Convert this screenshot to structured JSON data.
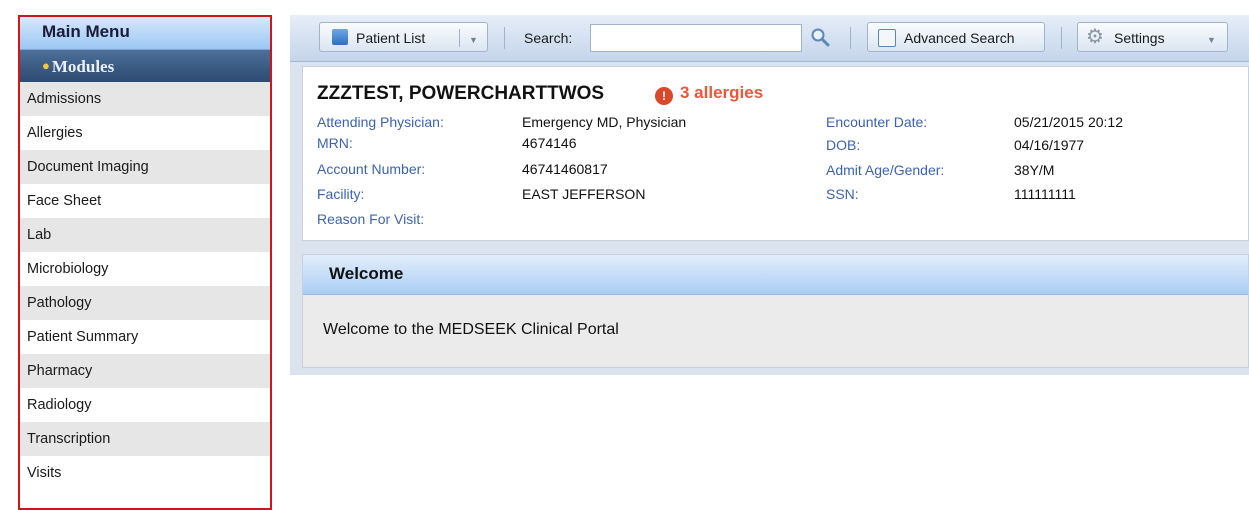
{
  "sidebar": {
    "title": "Main Menu",
    "section": "Modules",
    "items": [
      {
        "label": "Admissions"
      },
      {
        "label": "Allergies"
      },
      {
        "label": "Document Imaging"
      },
      {
        "label": "Face Sheet"
      },
      {
        "label": "Lab"
      },
      {
        "label": "Microbiology"
      },
      {
        "label": "Pathology"
      },
      {
        "label": "Patient Summary"
      },
      {
        "label": "Pharmacy"
      },
      {
        "label": "Radiology"
      },
      {
        "label": "Transcription"
      },
      {
        "label": "Visits"
      }
    ]
  },
  "toolbar": {
    "patient_list_label": "Patient List",
    "search_label": "Search:",
    "search_value": "",
    "advanced_search_label": "Advanced Search",
    "settings_label": "Settings",
    "icons": {
      "patient_list": "patient-list-icon",
      "search": "magnifier-icon",
      "advanced_search": "advanced-search-icon",
      "settings": "gear-icon"
    }
  },
  "patient": {
    "name": "ZZZTEST, POWERCHARTTWOS",
    "allergies": "3 allergies",
    "allergy_icon": "!",
    "fields_left": [
      {
        "label": "Attending Physician:",
        "value": "Emergency MD, Physician"
      },
      {
        "label": "MRN:",
        "value": "4674146"
      },
      {
        "label": "Account Number:",
        "value": "46741460817"
      },
      {
        "label": "Facility:",
        "value": "EAST JEFFERSON"
      },
      {
        "label": "Reason For Visit:",
        "value": ""
      }
    ],
    "fields_right": [
      {
        "label": "Encounter Date:",
        "value": "05/21/2015 20:12"
      },
      {
        "label": "DOB:",
        "value": "04/16/1977"
      },
      {
        "label": "Admit Age/Gender:",
        "value": "38Y/M"
      },
      {
        "label": "SSN:",
        "value": "111111111"
      }
    ]
  },
  "welcome": {
    "title": "Welcome",
    "message": "Welcome to the MEDSEEK Clinical Portal"
  },
  "colors": {
    "accent_border": "#d0161b",
    "label_blue": "#3d63ad",
    "allergy_red": "#e8583d",
    "header_blue": "#aacdf5"
  }
}
